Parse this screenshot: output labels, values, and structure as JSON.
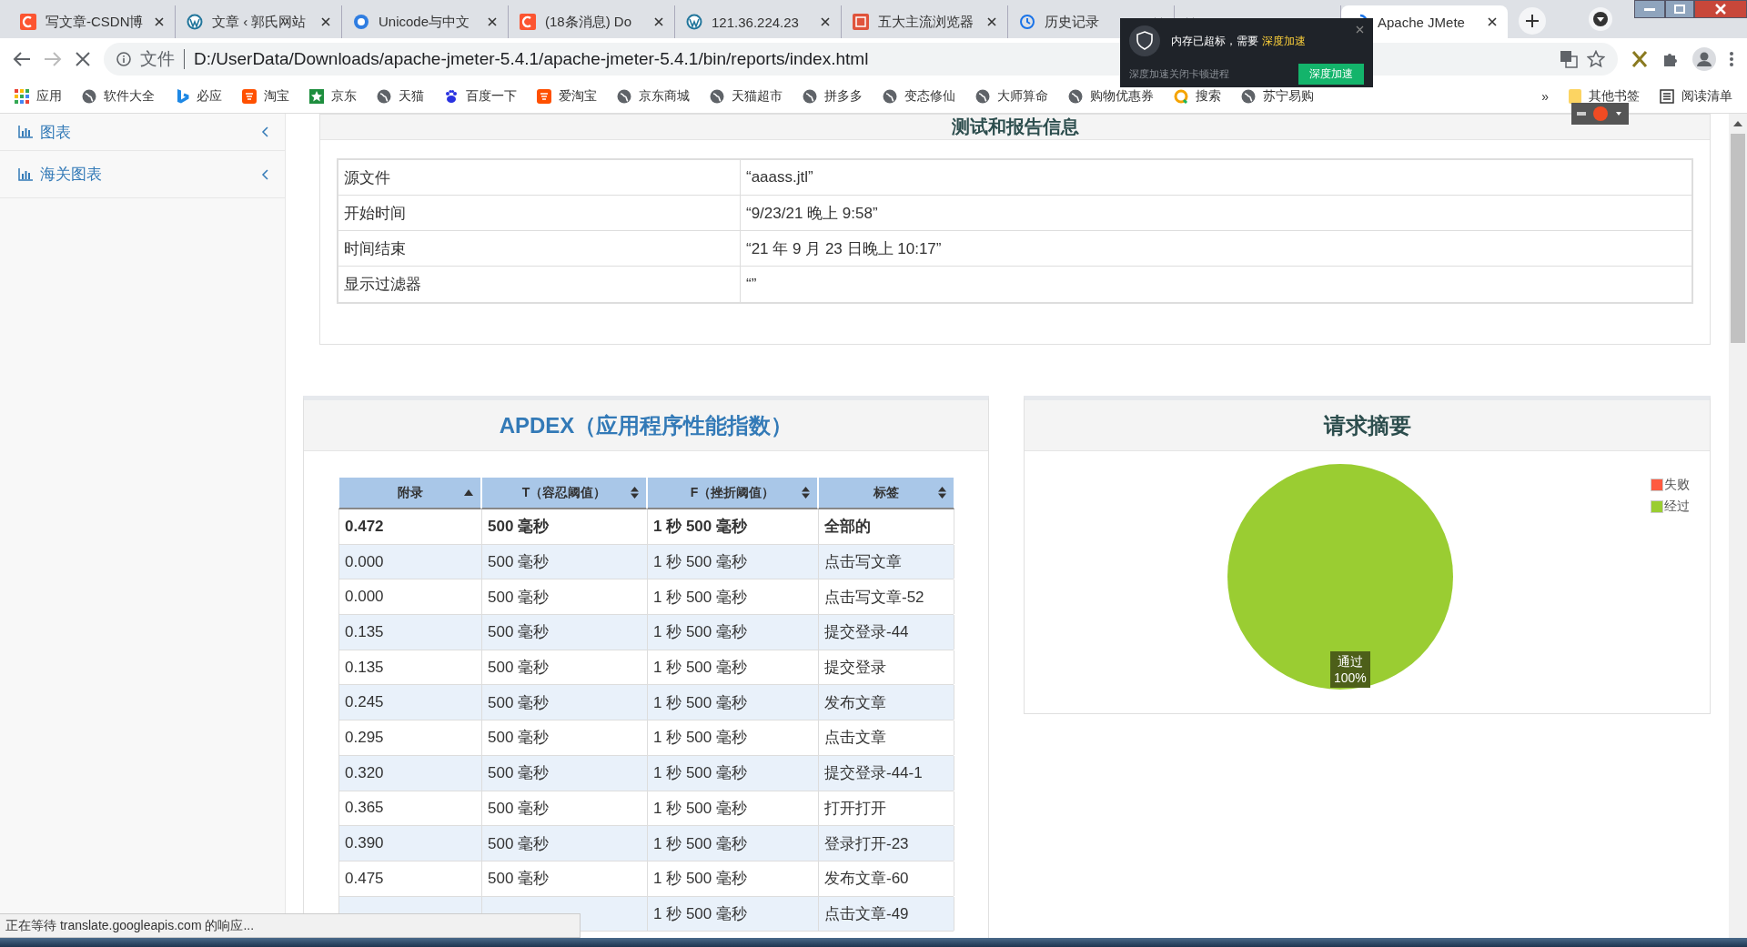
{
  "browser": {
    "tabs": [
      {
        "title": "写文章-CSDN博",
        "selected": false
      },
      {
        "title": "文章 ‹ 郭氏网站",
        "selected": false
      },
      {
        "title": "Unicode与中文",
        "selected": false
      },
      {
        "title": "(18条消息) Do",
        "selected": false
      },
      {
        "title": "121.36.224.23",
        "selected": false
      },
      {
        "title": "五大主流浏览器",
        "selected": false
      },
      {
        "title": "历史记录",
        "selected": false
      },
      {
        "selected": false
      },
      {
        "title": "Apache JMete",
        "selected": true
      }
    ],
    "address": {
      "scheme_label": "文件",
      "url": "D:/UserData/Downloads/apache-jmeter-5.4.1/apache-jmeter-5.4.1/bin/reports/index.html"
    },
    "bookmarks": [
      {
        "label": "应用"
      },
      {
        "label": "软件大全"
      },
      {
        "label": "必应"
      },
      {
        "label": "淘宝"
      },
      {
        "label": "京东"
      },
      {
        "label": "天猫"
      },
      {
        "label": "百度一下"
      },
      {
        "label": "爱淘宝"
      },
      {
        "label": "京东商城"
      },
      {
        "label": "天猫超市"
      },
      {
        "label": "拼多多"
      },
      {
        "label": "变态修仙"
      },
      {
        "label": "大师算命"
      },
      {
        "label": "购物优惠券"
      },
      {
        "label": "搜索"
      },
      {
        "label": "苏宁易购"
      }
    ],
    "overflow": "»",
    "other_bookmarks": "其他书签",
    "reading_list": "阅读清单"
  },
  "popup": {
    "message": "内存已超标，需要",
    "highlight": "深度加速",
    "subtext": "深度加速关闭卡顿进程",
    "button": "深度加速"
  },
  "sidebar": {
    "items": [
      {
        "label": "图表"
      },
      {
        "label": "海关图表"
      }
    ]
  },
  "info_panel": {
    "title": "测试和报告信息",
    "rows": [
      {
        "label": "源文件",
        "value": "“aaass.jtl”"
      },
      {
        "label": "开始时间",
        "value": "“9/23/21 晚上 9:58”"
      },
      {
        "label": "时间结束",
        "value": "“21 年 9 月 23 日晚上 10:17”"
      },
      {
        "label": "显示过滤器",
        "value": "“”"
      }
    ]
  },
  "apdex_panel": {
    "title": "APDEX（应用程序性能指数）",
    "columns": [
      {
        "label": "附录",
        "sorted": true
      },
      {
        "label": "T（容忍阈值）",
        "sorted": false
      },
      {
        "label": "F（挫折阈值）",
        "sorted": false
      },
      {
        "label": "标签",
        "sorted": false
      }
    ],
    "rows": [
      {
        "kind": "total",
        "apdex": "0.472",
        "t": "500 毫秒",
        "f": "1 秒 500 毫秒",
        "label": "全部的"
      },
      {
        "kind": "item",
        "apdex": "0.000",
        "t": "500 毫秒",
        "f": "1 秒 500 毫秒",
        "label": "点击写文章"
      },
      {
        "kind": "item",
        "apdex": "0.000",
        "t": "500 毫秒",
        "f": "1 秒 500 毫秒",
        "label": "点击写文章-52"
      },
      {
        "kind": "item",
        "apdex": "0.135",
        "t": "500 毫秒",
        "f": "1 秒 500 毫秒",
        "label": "提交登录-44"
      },
      {
        "kind": "item",
        "apdex": "0.135",
        "t": "500 毫秒",
        "f": "1 秒 500 毫秒",
        "label": "提交登录"
      },
      {
        "kind": "item",
        "apdex": "0.245",
        "t": "500 毫秒",
        "f": "1 秒 500 毫秒",
        "label": "发布文章"
      },
      {
        "kind": "item",
        "apdex": "0.295",
        "t": "500 毫秒",
        "f": "1 秒 500 毫秒",
        "label": "点击文章"
      },
      {
        "kind": "item",
        "apdex": "0.320",
        "t": "500 毫秒",
        "f": "1 秒 500 毫秒",
        "label": "提交登录-44-1"
      },
      {
        "kind": "item",
        "apdex": "0.365",
        "t": "500 毫秒",
        "f": "1 秒 500 毫秒",
        "label": "打开打开"
      },
      {
        "kind": "item",
        "apdex": "0.390",
        "t": "500 毫秒",
        "f": "1 秒 500 毫秒",
        "label": "登录打开-23"
      },
      {
        "kind": "item",
        "apdex": "0.475",
        "t": "500 毫秒",
        "f": "1 秒 500 毫秒",
        "label": "发布文章-60"
      },
      {
        "kind": "item",
        "f": "1 秒 500 毫秒",
        "label": "点击文章-49"
      }
    ]
  },
  "summary_panel": {
    "title": "请求摘要",
    "chart_data": {
      "type": "pie",
      "categories": [
        "失败",
        "经过"
      ],
      "values": [
        0,
        100
      ]
    },
    "slice_label": {
      "name": "通过",
      "percent": "100%"
    }
  },
  "status_bar": {
    "text": "正在等待 translate.googleapis.com 的响应..."
  }
}
